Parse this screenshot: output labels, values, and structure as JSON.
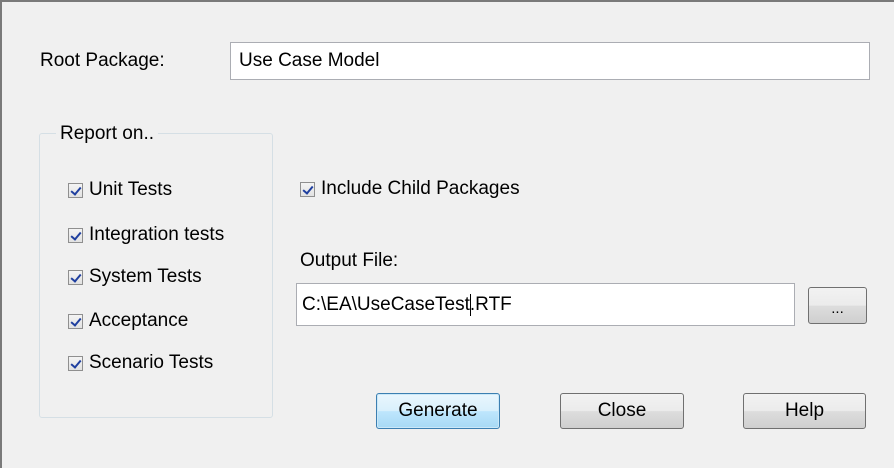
{
  "root_package": {
    "label": "Root Package:",
    "value": "Use Case Model"
  },
  "report_on": {
    "title": "Report on..",
    "items": [
      {
        "label": "Unit Tests",
        "checked": true
      },
      {
        "label": "Integration tests",
        "checked": true
      },
      {
        "label": "System Tests",
        "checked": true
      },
      {
        "label": "Acceptance",
        "checked": true
      },
      {
        "label": "Scenario Tests",
        "checked": true
      }
    ]
  },
  "include_child": {
    "label": "Include Child Packages",
    "checked": true
  },
  "output_file": {
    "label": "Output File:",
    "value_before_caret": "C:\\EA\\UseCaseTest",
    "value_after_caret": ".RTF",
    "browse_label": "..."
  },
  "buttons": {
    "generate": "Generate",
    "close": "Close",
    "help": "Help"
  }
}
